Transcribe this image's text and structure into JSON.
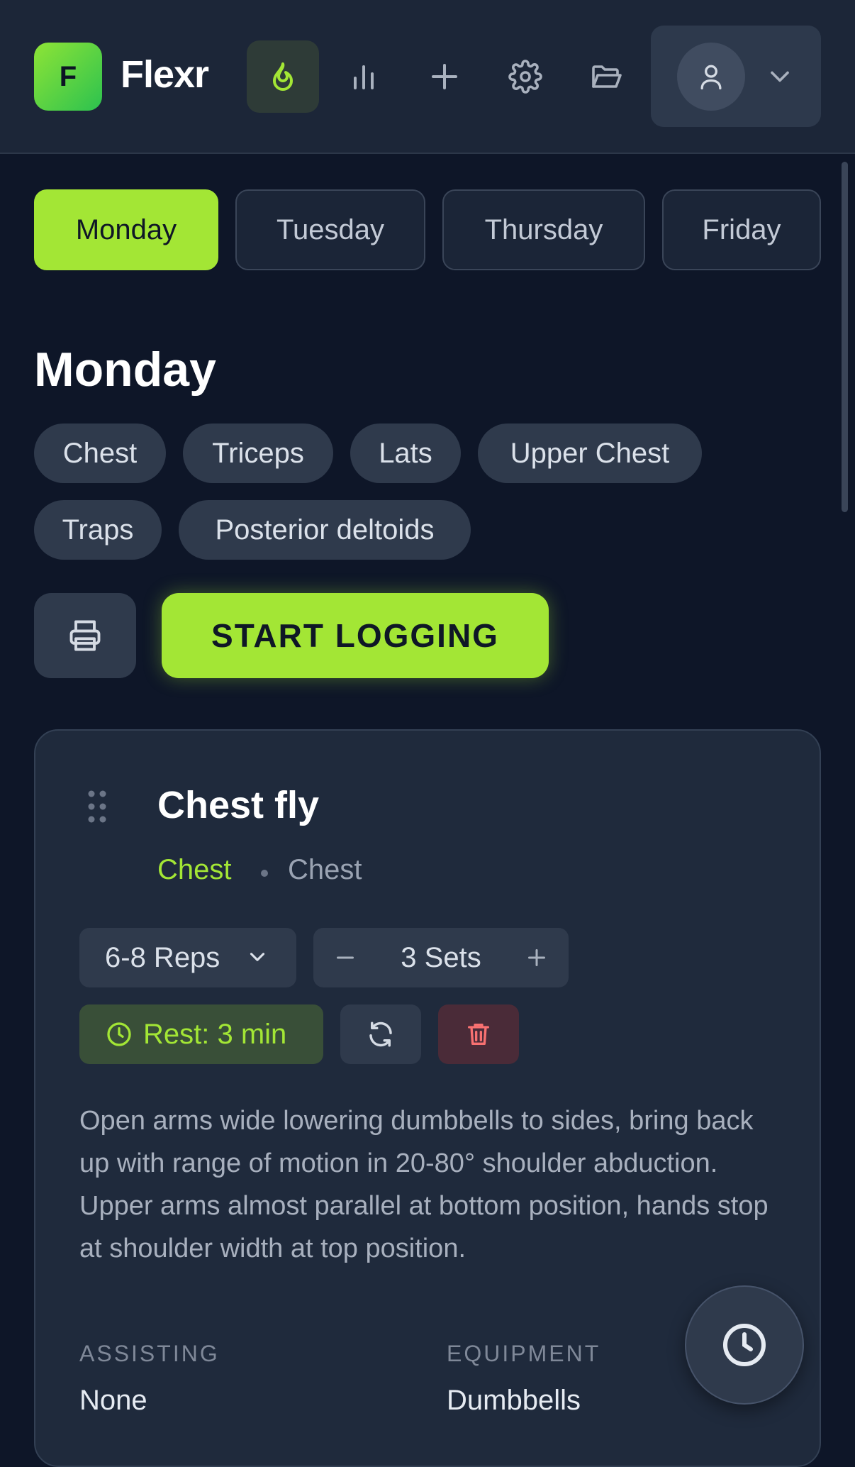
{
  "app": {
    "logo_letter": "F",
    "name": "Flexr"
  },
  "nav": {
    "items": [
      {
        "icon": "flame-icon",
        "active": true
      },
      {
        "icon": "bar-chart-icon",
        "active": false
      },
      {
        "icon": "plus-icon",
        "active": false
      },
      {
        "icon": "gear-icon",
        "active": false
      },
      {
        "icon": "folder-open-icon",
        "active": false
      }
    ],
    "profile": {
      "icon": "user-icon",
      "dropdown_icon": "chevron-down-icon"
    }
  },
  "days": {
    "tabs": [
      {
        "label": "Monday",
        "active": true
      },
      {
        "label": "Tuesday",
        "active": false
      },
      {
        "label": "Thursday",
        "active": false
      },
      {
        "label": "Friday",
        "active": false
      }
    ]
  },
  "workout": {
    "title": "Monday",
    "muscle_chips": [
      "Chest",
      "Triceps",
      "Lats",
      "Upper Chest",
      "Traps",
      "Posterior deltoids"
    ],
    "start_label": "START LOGGING"
  },
  "exercise": {
    "name": "Chest fly",
    "primary_muscle": "Chest",
    "secondary_muscle": "Chest",
    "reps": "6-8 Reps",
    "sets": "3 Sets",
    "rest": "Rest: 3 min",
    "description": "Open arms wide lowering dumbbells to sides, bring back up with range of motion in 20-80° shoulder abduction. Upper arms almost parallel at bottom position, hands stop at shoulder width at top position.",
    "assisting_label": "ASSISTING",
    "assisting_value": "None",
    "equipment_label": "EQUIPMENT",
    "equipment_value": "Dumbbells"
  },
  "colors": {
    "accent": "#a3e635",
    "background": "#0e1628",
    "card": "#1f2a3c",
    "danger": "#f87171"
  }
}
